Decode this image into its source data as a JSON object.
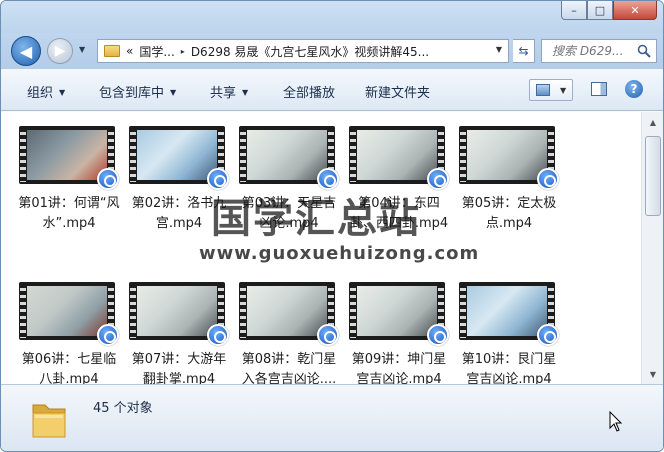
{
  "window": {
    "controls": {
      "minimize": "–",
      "maximize": "□",
      "close": "✕"
    }
  },
  "nav": {
    "back_icon": "◀",
    "forward_icon": "▶",
    "address": {
      "overflow": "«",
      "segments": [
        "国学...",
        "D6298 易晟《九宫七星风水》视频讲解45..."
      ],
      "separator": "▸"
    },
    "refresh_icon": "⇆",
    "search_placeholder": "搜索 D629..."
  },
  "toolbar": {
    "organize": "组织",
    "include_library": "包含到库中",
    "share": "共享",
    "play_all": "全部播放",
    "new_folder": "新建文件夹",
    "caret": "▼",
    "help": "?"
  },
  "files": [
    {
      "name": "第01讲：何谓“风水”.mp4",
      "tone": "red"
    },
    {
      "name": "第02讲：洛书九宫.mp4",
      "tone": "blue"
    },
    {
      "name": "第03讲：天星吉凶论.mp4",
      "tone": "paper"
    },
    {
      "name": "第04讲：东四卦、西四卦.mp4",
      "tone": "paper"
    },
    {
      "name": "第05讲：定太极点.mp4",
      "tone": "paper"
    },
    {
      "name": "第06讲：七星临八卦.mp4",
      "tone": "board"
    },
    {
      "name": "第07讲：大游年翻卦掌.mp4",
      "tone": "paper"
    },
    {
      "name": "第08讲：乾门星入各宫吉凶论....",
      "tone": "paper"
    },
    {
      "name": "第09讲：坤门星宫吉凶论.mp4",
      "tone": "paper"
    },
    {
      "name": "第10讲：艮门星宫吉凶论.mp4",
      "tone": "blue"
    }
  ],
  "watermark": {
    "title": "国学汇总站",
    "url": "www.guoxuehuizong.com"
  },
  "status": {
    "count_text": "45 个对象"
  },
  "colors": {
    "accent": "#1f5fae",
    "titlebar": "#cfe1f3",
    "close": "#c7473a"
  }
}
